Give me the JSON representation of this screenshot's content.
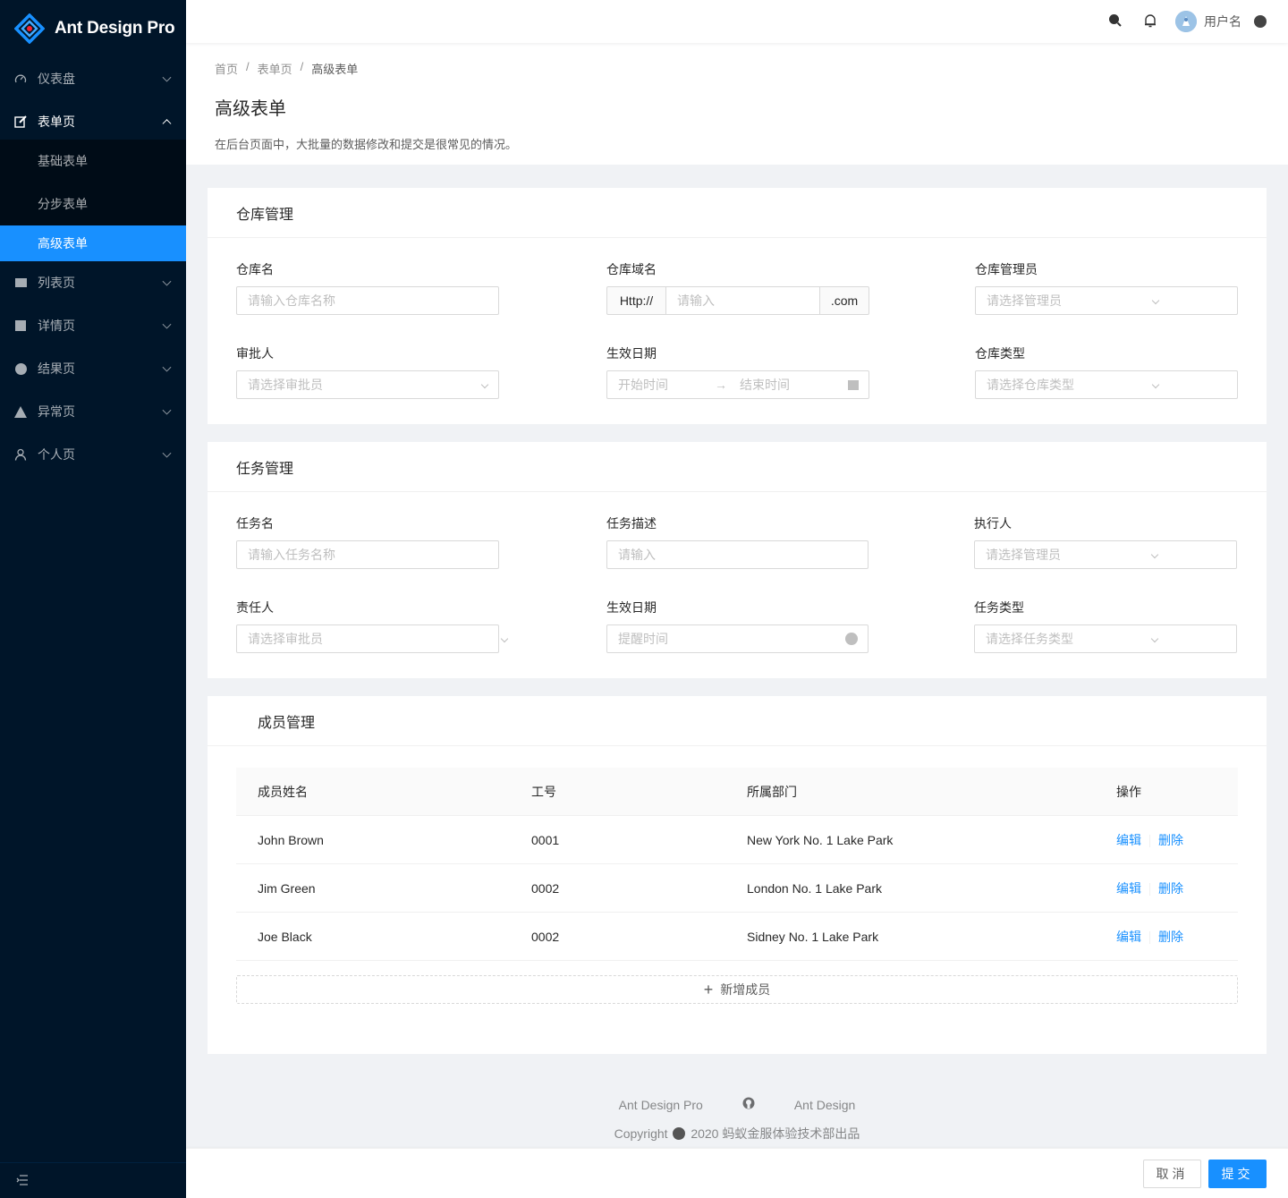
{
  "app": {
    "title": "Ant Design Pro"
  },
  "sidebar": {
    "items": [
      {
        "label": "仪表盘",
        "icon": "dashboard-icon"
      },
      {
        "label": "表单页",
        "icon": "form-icon",
        "open": true,
        "children": [
          {
            "label": "基础表单"
          },
          {
            "label": "分步表单"
          },
          {
            "label": "高级表单",
            "active": true
          }
        ]
      },
      {
        "label": "列表页",
        "icon": "table-icon"
      },
      {
        "label": "详情页",
        "icon": "profile-icon"
      },
      {
        "label": "结果页",
        "icon": "check-circle-icon"
      },
      {
        "label": "异常页",
        "icon": "warning-icon"
      },
      {
        "label": "个人页",
        "icon": "user-icon"
      }
    ]
  },
  "header": {
    "user_name": "用户名"
  },
  "page": {
    "breadcrumb": [
      "首页",
      "表单页",
      "高级表单"
    ],
    "title": "高级表单",
    "description": "在后台页面中，大批量的数据修改和提交是很常见的情况。"
  },
  "warehouse": {
    "title": "仓库管理",
    "name": {
      "label": "仓库名",
      "placeholder": "请输入仓库名称"
    },
    "domain": {
      "label": "仓库域名",
      "prefix": "Http://",
      "placeholder": "请输入",
      "suffix": ".com"
    },
    "admin": {
      "label": "仓库管理员",
      "placeholder": "请选择管理员"
    },
    "approver": {
      "label": "审批人",
      "placeholder": "请选择审批员"
    },
    "date": {
      "label": "生效日期",
      "start": "开始时间",
      "end": "结束时间"
    },
    "type": {
      "label": "仓库类型",
      "placeholder": "请选择仓库类型"
    }
  },
  "task": {
    "title": "任务管理",
    "name": {
      "label": "任务名",
      "placeholder": "请输入任务名称"
    },
    "desc": {
      "label": "任务描述",
      "placeholder": "请输入"
    },
    "executor": {
      "label": "执行人",
      "placeholder": "请选择管理员"
    },
    "owner": {
      "label": "责任人",
      "placeholder": "请选择审批员"
    },
    "date": {
      "label": "生效日期",
      "placeholder": "提醒时间"
    },
    "type": {
      "label": "任务类型",
      "placeholder": "请选择任务类型"
    }
  },
  "members": {
    "title": "成员管理",
    "columns": [
      "成员姓名",
      "工号",
      "所属部门",
      "操作"
    ],
    "rows": [
      {
        "name": "John Brown",
        "id": "0001",
        "dept": "New York No. 1 Lake Park"
      },
      {
        "name": "Jim Green",
        "id": "0002",
        "dept": "London No. 1 Lake Park"
      },
      {
        "name": "Joe Black",
        "id": "0002",
        "dept": "Sidney No. 1 Lake Park"
      }
    ],
    "edit_label": "编辑",
    "delete_label": "删除",
    "add_label": "新增成员"
  },
  "footer": {
    "links": [
      "Ant Design Pro",
      "Ant Design"
    ],
    "copyright_prefix": "Copyright",
    "copyright_text": "2020 蚂蚁金服体验技术部出品"
  },
  "toolbar": {
    "cancel": "取消",
    "submit": "提交"
  },
  "colors": {
    "primary": "#1890ff",
    "sider": "#001529"
  }
}
